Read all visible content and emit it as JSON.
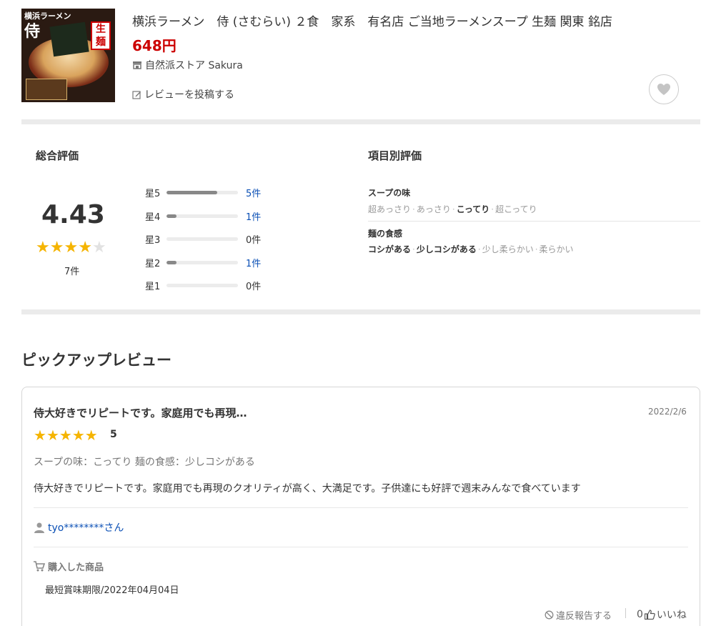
{
  "product": {
    "thumb_text_top": "横浜ラーメン",
    "thumb_text_main": "侍",
    "thumb_badge": "生麺",
    "title": "横浜ラーメン　侍 (さむらい) ２食　家系　有名店 ご当地ラーメンスープ 生麺 関東 銘店",
    "price": "648円",
    "store_name": "自然派ストア Sakura",
    "store_icon": "store-icon",
    "post_review_label": "レビューを投稿する",
    "favorite_icon": "heart-icon"
  },
  "ratings": {
    "overall_heading": "総合評価",
    "average": "4.43",
    "average_value": 4.43,
    "review_count": "7件",
    "distribution": [
      {
        "label": "星5",
        "count": "5件",
        "value": 5
      },
      {
        "label": "星4",
        "count": "1件",
        "value": 1
      },
      {
        "label": "星3",
        "count": "0件",
        "value": 0
      },
      {
        "label": "星2",
        "count": "1件",
        "value": 1
      },
      {
        "label": "星1",
        "count": "0件",
        "value": 0
      }
    ],
    "items_heading": "項目別評価",
    "attributes": [
      {
        "name": "スープの味",
        "options": [
          "超あっさり",
          "あっさり",
          "こってり",
          "超こってり"
        ],
        "selected": "こってり"
      },
      {
        "name": "麺の食感",
        "options": [
          "コシがある",
          "少しコシがある",
          "少し柔らかい",
          "柔らかい"
        ],
        "selected": [
          "コシがある",
          "少しコシがある"
        ]
      }
    ]
  },
  "pickup": {
    "heading": "ピックアップレビュー",
    "review": {
      "title": "侍大好きでリピートです。家庭用でも再現…",
      "date": "2022/2/6",
      "stars": 5,
      "score": "5",
      "attributes_text": "スープの味：こってり 麺の食感：少しコシがある",
      "body": "侍大好きでリピートです。家庭用でも再現のクオリティが高く、大満足です。子供達にも好評で週末みんなで食べています",
      "user": "tyo********さん",
      "purchased_label": "購入した商品",
      "purchased_item": "最短賞味期限/2022年04月04日",
      "report_label": "違反報告する",
      "like_count": "0",
      "like_label": "いいね"
    }
  },
  "colors": {
    "price": "#cc0000",
    "star": "#f5b400",
    "link": "#0a4fb5"
  }
}
